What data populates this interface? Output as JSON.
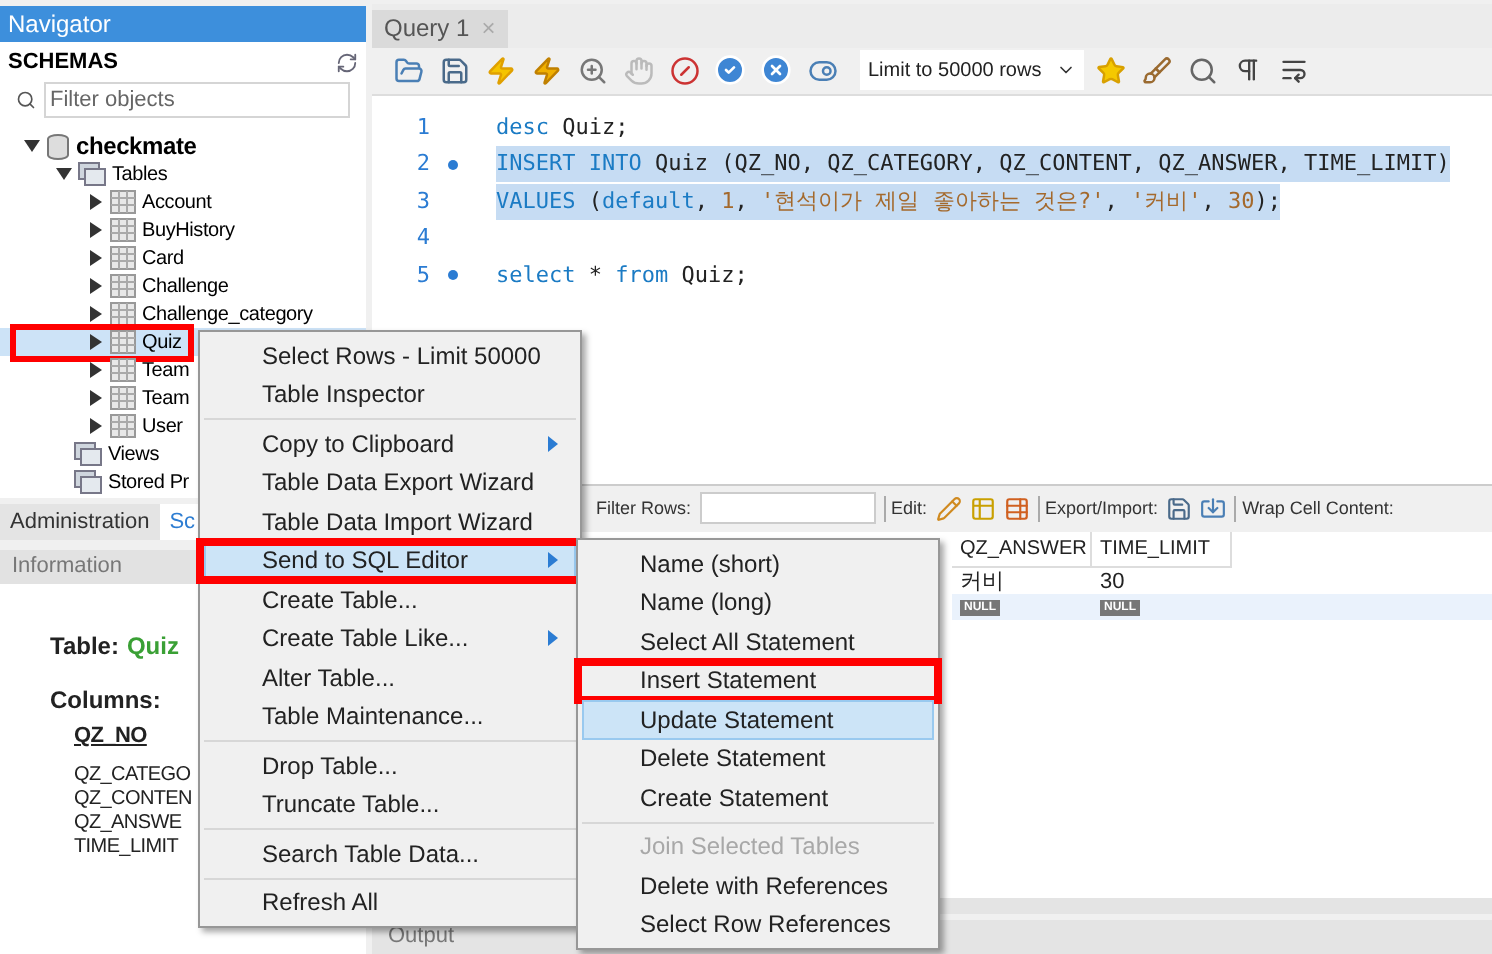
{
  "navigator": {
    "title": "Navigator",
    "schemas_label": "SCHEMAS",
    "filter": {
      "placeholder": "Filter objects"
    },
    "tree": [
      {
        "label": "checkmate",
        "kind": "schema",
        "expanded": true,
        "selected": false,
        "annotated": false,
        "children": [
          {
            "label": "Tables",
            "kind": "folder",
            "expanded": true,
            "selected": false,
            "annotated": false,
            "children": [
              {
                "label": "Account",
                "kind": "table",
                "expanded": false,
                "selected": false,
                "annotated": false
              },
              {
                "label": "BuyHistory",
                "kind": "table",
                "expanded": false,
                "selected": false,
                "annotated": false
              },
              {
                "label": "Card",
                "kind": "table",
                "expanded": false,
                "selected": false,
                "annotated": false
              },
              {
                "label": "Challenge",
                "kind": "table",
                "expanded": false,
                "selected": false,
                "annotated": false
              },
              {
                "label": "Challenge_category",
                "kind": "table",
                "expanded": false,
                "selected": false,
                "annotated": false
              },
              {
                "label": "Quiz",
                "kind": "table",
                "expanded": false,
                "selected": true,
                "annotated": true
              },
              {
                "label": "Team",
                "kind": "table",
                "expanded": false,
                "selected": false,
                "annotated": false
              },
              {
                "label": "Team",
                "kind": "table",
                "expanded": false,
                "selected": false,
                "annotated": false
              },
              {
                "label": "User",
                "kind": "table",
                "expanded": false,
                "selected": false,
                "annotated": false
              }
            ]
          },
          {
            "label": "Views",
            "kind": "folder",
            "selected": false,
            "annotated": false
          },
          {
            "label": "Stored Pr",
            "kind": "folder",
            "selected": false,
            "annotated": false
          }
        ]
      }
    ],
    "tabs": [
      {
        "label": "Administration",
        "selected": false
      },
      {
        "label": "Sc",
        "selected": true
      }
    ]
  },
  "information": {
    "title": "Information",
    "table_label": "Table:",
    "table_name": "Quiz",
    "columns_label": "Columns:",
    "columns": [
      {
        "name": "QZ_NO",
        "primary": true
      },
      {
        "name": "QZ_CATEGO",
        "primary": false
      },
      {
        "name": "QZ_CONTEN",
        "primary": false
      },
      {
        "name": "QZ_ANSWE",
        "primary": false
      },
      {
        "name": "TIME_LIMIT",
        "primary": false
      }
    ]
  },
  "editor": {
    "tab": {
      "label": "Query 1",
      "close": "×"
    },
    "limit": "Limit to 50000 rows",
    "lines": [
      {
        "number": "1",
        "marker": false,
        "selected": false,
        "tokens": [
          {
            "t": "desc ",
            "color": "#1b7bc4"
          },
          {
            "t": "Quiz;",
            "color": "#222222"
          }
        ]
      },
      {
        "number": "2",
        "marker": true,
        "selected": true,
        "tokens": [
          {
            "t": "INSERT INTO ",
            "color": "#1b7bc4"
          },
          {
            "t": "Quiz (QZ_NO, QZ_CATEGORY, QZ_CONTENT, QZ_ANSWER, TIME_LIMIT)",
            "color": "#222222"
          }
        ]
      },
      {
        "number": "3",
        "marker": false,
        "selected": true,
        "tokens": [
          {
            "t": "VALUES ",
            "color": "#1b7bc4"
          },
          {
            "t": "(",
            "color": "#222222"
          },
          {
            "t": "default",
            "color": "#1b7bc4"
          },
          {
            "t": ", ",
            "color": "#222222"
          },
          {
            "t": "1",
            "color": "#a4692c"
          },
          {
            "t": ", ",
            "color": "#222222"
          },
          {
            "t": "'현석이가 제일 좋아하는 것은?'",
            "color": "#a4692c"
          },
          {
            "t": ", ",
            "color": "#222222"
          },
          {
            "t": "'커비'",
            "color": "#a4692c"
          },
          {
            "t": ", ",
            "color": "#222222"
          },
          {
            "t": "30",
            "color": "#a4692c"
          },
          {
            "t": ");",
            "color": "#222222"
          }
        ]
      },
      {
        "number": "4",
        "marker": false
      },
      {
        "number": "5",
        "marker": true,
        "selected": false,
        "tokens": [
          {
            "t": "select ",
            "color": "#1b7bc4"
          },
          {
            "t": "* ",
            "color": "#222222"
          },
          {
            "t": "from ",
            "color": "#1b7bc4"
          },
          {
            "t": "Quiz;",
            "color": "#222222"
          }
        ]
      }
    ]
  },
  "result": {
    "filter_label": "Filter Rows:",
    "edit_label": "Edit:",
    "export_label": "Export/Import:",
    "wrap_label": "Wrap Cell Content:",
    "columns": [
      "QZ_ANSWER",
      "TIME_LIMIT"
    ],
    "rows": [
      {
        "kind": "data",
        "cells": [
          "커비",
          "30"
        ]
      },
      {
        "kind": "new",
        "cells": [
          "NULL",
          "NULL"
        ]
      }
    ]
  },
  "output": {
    "title": "Output"
  },
  "context_menu": {
    "groups": [
      [
        {
          "label": "Select Rows - Limit 50000",
          "submenu": false,
          "highlighted": false,
          "annotated": false
        },
        {
          "label": "Table Inspector",
          "submenu": false,
          "highlighted": false,
          "annotated": false
        }
      ],
      [
        {
          "label": "Copy to Clipboard",
          "submenu": true,
          "highlighted": false,
          "annotated": false
        },
        {
          "label": "Table Data Export Wizard",
          "submenu": false,
          "highlighted": false,
          "annotated": false
        },
        {
          "label": "Table Data Import Wizard",
          "submenu": false,
          "highlighted": false,
          "annotated": false
        },
        {
          "label": "Send to SQL Editor",
          "submenu": true,
          "highlighted": true,
          "annotated": true
        },
        {
          "label": "Create Table...",
          "submenu": false,
          "highlighted": false,
          "annotated": false
        },
        {
          "label": "Create Table Like...",
          "submenu": true,
          "highlighted": false,
          "annotated": false
        },
        {
          "label": "Alter Table...",
          "submenu": false,
          "highlighted": false,
          "annotated": false
        },
        {
          "label": "Table Maintenance...",
          "submenu": false,
          "highlighted": false,
          "annotated": false
        }
      ],
      [
        {
          "label": "Drop Table...",
          "submenu": false,
          "highlighted": false,
          "annotated": false
        },
        {
          "label": "Truncate Table...",
          "submenu": false,
          "highlighted": false,
          "annotated": false
        }
      ],
      [
        {
          "label": "Search Table Data...",
          "submenu": false,
          "highlighted": false,
          "annotated": false
        }
      ],
      [
        {
          "label": "Refresh All",
          "submenu": false,
          "highlighted": false,
          "annotated": false
        }
      ]
    ]
  },
  "submenu": {
    "groups": [
      [
        {
          "label": "Name (short)",
          "disabled": false,
          "highlighted": false,
          "annotated": false
        },
        {
          "label": "Name (long)",
          "disabled": false,
          "highlighted": false,
          "annotated": false
        },
        {
          "label": "Select All Statement",
          "disabled": false,
          "highlighted": false,
          "annotated": false
        },
        {
          "label": "Insert Statement",
          "disabled": false,
          "highlighted": false,
          "annotated": true
        },
        {
          "label": "Update Statement",
          "disabled": false,
          "highlighted": true,
          "annotated": false
        },
        {
          "label": "Delete Statement",
          "disabled": false,
          "highlighted": false,
          "annotated": false
        },
        {
          "label": "Create Statement",
          "disabled": false,
          "highlighted": false,
          "annotated": false
        }
      ],
      [
        {
          "label": "Join Selected Tables",
          "disabled": true,
          "highlighted": false,
          "annotated": false
        },
        {
          "label": "Delete with References",
          "disabled": false,
          "highlighted": false,
          "annotated": false
        },
        {
          "label": "Select Row References",
          "disabled": false,
          "highlighted": false,
          "annotated": false
        }
      ]
    ]
  }
}
